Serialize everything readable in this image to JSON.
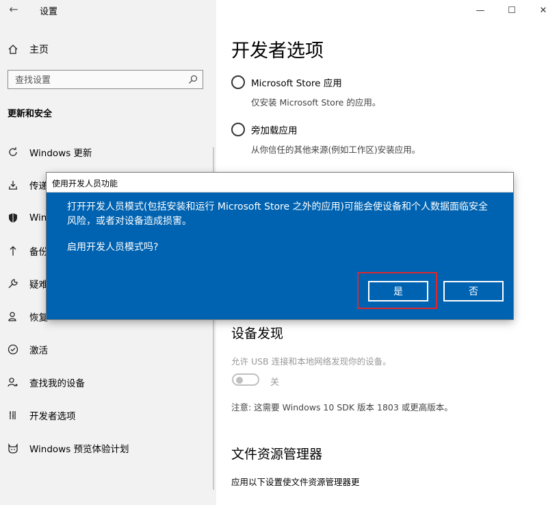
{
  "window": {
    "title": "设置",
    "controls": [
      "—",
      "☐",
      "✕"
    ]
  },
  "sidebar": {
    "home": "主页",
    "search_placeholder": "查找设置",
    "section": "更新和安全",
    "items": [
      {
        "label": "Windows 更新",
        "icon": "refresh-icon"
      },
      {
        "label": "传递",
        "icon": "delivery-icon"
      },
      {
        "label": "Win",
        "icon": "shield-icon"
      },
      {
        "label": "备份",
        "icon": "backup-icon"
      },
      {
        "label": "疑难",
        "icon": "wrench-icon"
      },
      {
        "label": "恢复",
        "icon": "recovery-icon"
      },
      {
        "label": "激活",
        "icon": "check-circle-icon"
      },
      {
        "label": "查找我的设备",
        "icon": "person-pin-icon"
      },
      {
        "label": "开发者选项",
        "icon": "tools-icon"
      },
      {
        "label": "Windows 预览体验计划",
        "icon": "cat-icon"
      }
    ]
  },
  "main": {
    "title": "开发者选项",
    "options": [
      {
        "label": "Microsoft Store 应用",
        "desc": "仅安装 Microsoft Store 的应用。"
      },
      {
        "label": "旁加载应用",
        "desc": "从你信任的其他来源(例如工作区)安装应用。"
      }
    ],
    "device_discovery": {
      "heading": "设备发现",
      "desc": "允许 USB 连接和本地网络发现你的设备。",
      "toggle_state": "关",
      "note": "注意: 这需要 Windows 10 SDK 版本 1803 或更高版本。"
    },
    "file_explorer": {
      "heading": "文件资源管理器",
      "desc": "应用以下设置使文件资源管理器更"
    }
  },
  "dialog": {
    "title": "使用开发人员功能",
    "message": "打开开发人员模式(包括安装和运行 Microsoft Store 之外的应用)可能会使设备和个人数据面临安全风险，或者对设备造成损害。",
    "question": "启用开发人员模式吗?",
    "yes": "是",
    "no": "否"
  },
  "colors": {
    "dialog_bg": "#0063b1",
    "highlight": "#e0262b",
    "sidebar_bg": "#f2f2f2"
  }
}
